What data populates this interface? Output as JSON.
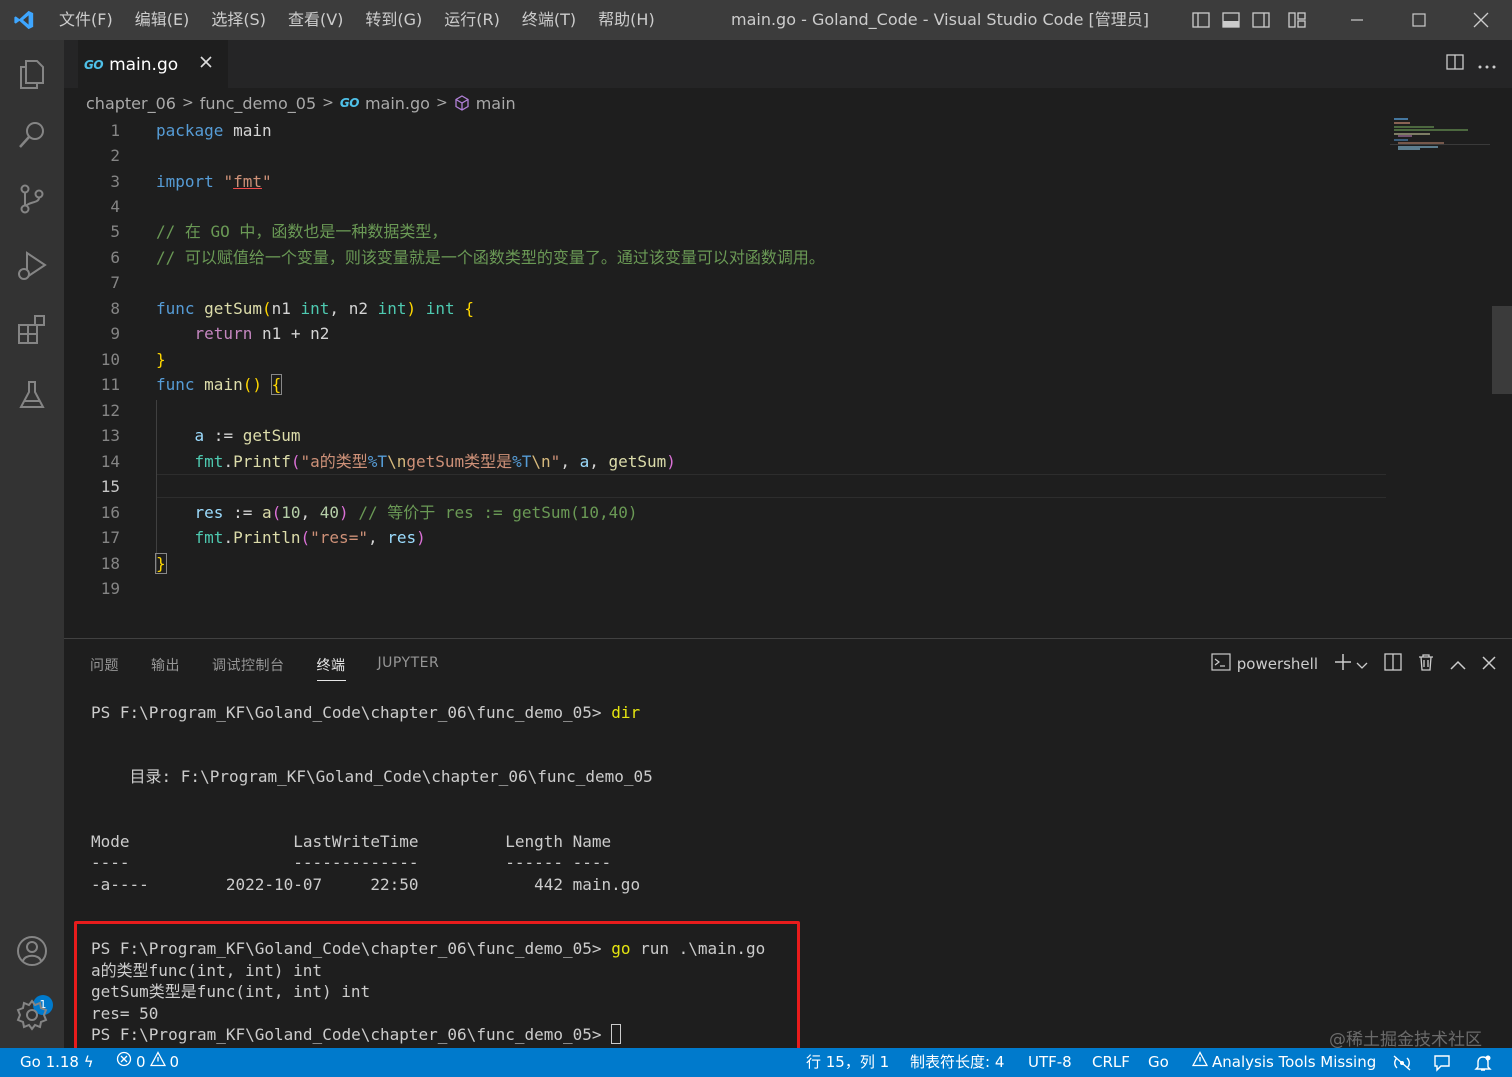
{
  "titlebar": {
    "menu": [
      "文件(F)",
      "编辑(E)",
      "选择(S)",
      "查看(V)",
      "转到(G)",
      "运行(R)",
      "终端(T)",
      "帮助(H)"
    ],
    "title": "main.go - Goland_Code - Visual Studio Code [管理员]"
  },
  "tab": {
    "go_badge": "GO",
    "label": "main.go"
  },
  "breadcrumb": {
    "items": [
      "chapter_06",
      "func_demo_05",
      "main.go",
      "main"
    ]
  },
  "editor": {
    "line_numbers": [
      "1",
      "2",
      "3",
      "4",
      "5",
      "6",
      "7",
      "8",
      "9",
      "10",
      "11",
      "12",
      "13",
      "14",
      "15",
      "16",
      "17",
      "18",
      "19"
    ],
    "active_line": "15"
  },
  "panel": {
    "tabs": [
      "问题",
      "输出",
      "调试控制台",
      "终端",
      "JUPYTER"
    ],
    "active_tab": "终端",
    "shell": "powershell",
    "terminal": {
      "prompt": "PS F:\\Program_KF\\Goland_Code\\chapter_06\\func_demo_05>",
      "cmd1": "dir",
      "dir_header": "    目录: F:\\Program_KF\\Goland_Code\\chapter_06\\func_demo_05",
      "col_header": "Mode                 LastWriteTime         Length Name",
      "col_sep": "----                 -------------         ------ ----",
      "row1": "-a----        2022-10-07     22:50            442 main.go",
      "cmd2": "go",
      "cmd2_rest": " run .\\main.go",
      "out1": "a的类型func(int, int) int",
      "out2": "getSum类型是func(int, int) int",
      "out3": "res= 50"
    }
  },
  "statusbar": {
    "go_version": "Go 1.18",
    "errors": "0",
    "warnings": "0",
    "cursor_pos": "行 15，列 1",
    "tab_size": "制表符长度: 4",
    "encoding": "UTF-8",
    "eol": "CRLF",
    "language": "Go",
    "analysis": "Analysis Tools Missing"
  },
  "watermark": "@稀土掘金技术社区",
  "colors": {
    "accent": "#007acc",
    "titlebar": "#3c3c3c",
    "activitybar": "#333333",
    "editor_bg": "#1e1e1e",
    "highlight": "#e81c1c"
  }
}
